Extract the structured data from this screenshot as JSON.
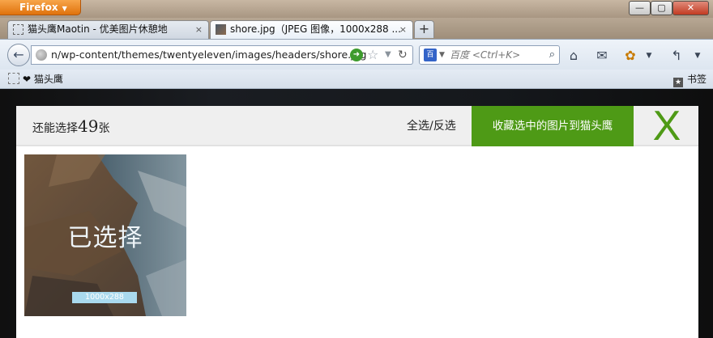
{
  "browser": {
    "menu_button": "Firefox",
    "window_controls": {
      "minimize": "—",
      "restore": "▢",
      "close": "✕"
    },
    "tabs": [
      {
        "title": "猫头鹰Maotin - 优美图片休憩地",
        "close": "×",
        "active": false
      },
      {
        "title": "shore.jpg（JPEG 图像，1000x288 ...",
        "close": "×",
        "active": true
      }
    ],
    "new_tab": "+",
    "address": {
      "url": "n/wp-content/themes/twentyeleven/images/headers/shore.jpg"
    },
    "search": {
      "placeholder": "百度 <Ctrl+K>",
      "engine_glyph": "百"
    },
    "bookmarks_bar": {
      "item": "猫头鹰",
      "item_prefix": "❤",
      "library": "书签"
    }
  },
  "overlay": {
    "counter_prefix": "还能选择",
    "counter_number": "49",
    "counter_suffix": "张",
    "select_all": "全选/反选",
    "save_button": "收藏选中的图片到猫头鹰",
    "close_button": "X",
    "images": [
      {
        "state_label": "已选择",
        "size_label": "1000x288"
      }
    ]
  },
  "colors": {
    "accent": "#4e9a16",
    "size_badge": "#a9d9ee",
    "header_bg": "#efefef"
  }
}
